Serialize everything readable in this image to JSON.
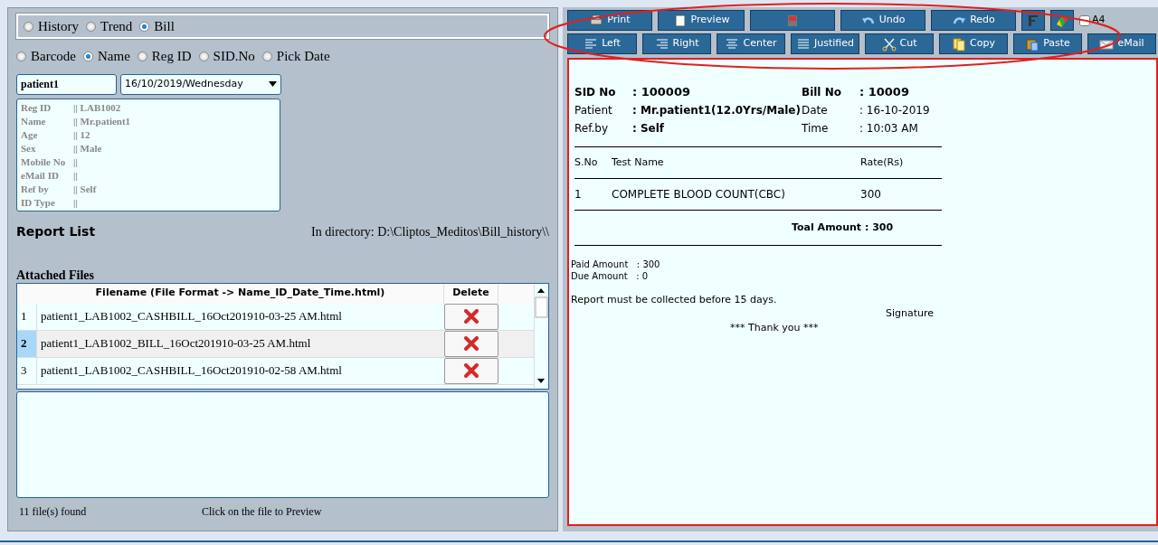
{
  "mode_options": [
    {
      "label": "History",
      "selected": false
    },
    {
      "label": "Trend",
      "selected": false
    },
    {
      "label": "Bill",
      "selected": true
    }
  ],
  "search_by": [
    {
      "label": "Barcode",
      "selected": false
    },
    {
      "label": "Name",
      "selected": true
    },
    {
      "label": "Reg ID",
      "selected": false
    },
    {
      "label": "SID.No",
      "selected": false
    },
    {
      "label": "Pick Date",
      "selected": false
    }
  ],
  "name_field": {
    "value": "patient1"
  },
  "date_dropdown": {
    "value": "16/10/2019/Wednesday"
  },
  "patient_info": [
    {
      "label": "Reg ID",
      "value": "|| LAB1002"
    },
    {
      "label": "Name",
      "value": "|| Mr.patient1"
    },
    {
      "label": "Age",
      "value": "|| 12"
    },
    {
      "label": "Sex",
      "value": "|| Male"
    },
    {
      "label": "Mobile No",
      "value": "||"
    },
    {
      "label": "eMail ID",
      "value": "||"
    },
    {
      "label": "Ref by",
      "value": "|| Self"
    },
    {
      "label": "ID Type",
      "value": "||"
    }
  ],
  "report_list": {
    "title": "Report List",
    "directory": "In directory:  D:\\Cliptos_Meditos\\Bill_history\\\\"
  },
  "attached_files": {
    "title": "Attached Files",
    "columns": [
      "Filename (File Format -> Name_ID_Date_Time.html)",
      "Delete"
    ],
    "rows": [
      {
        "index": "1",
        "filename": "patient1_LAB1002_CASHBILL_16Oct201910-03-25 AM.html",
        "selected": false
      },
      {
        "index": "2",
        "filename": "patient1_LAB1002_BILL_16Oct201910-03-25 AM.html",
        "selected": true
      },
      {
        "index": "3",
        "filename": "patient1_LAB1002_CASHBILL_16Oct201910-02-58 AM.html",
        "selected": false
      }
    ]
  },
  "status": {
    "count": "11 file(s) found",
    "hint": "Click on the file to Preview"
  },
  "toolbar_rows": [
    [
      {
        "kind": "print",
        "label": "Print"
      },
      {
        "kind": "preview",
        "label": "Preview"
      },
      {
        "kind": "pdf"
      },
      {
        "kind": "undo",
        "label": "Undo"
      },
      {
        "kind": "redo",
        "label": "Redo"
      },
      {
        "kind": "font"
      },
      {
        "kind": "color"
      },
      {
        "kind": "check",
        "label": "A4",
        "checked": false
      }
    ],
    [
      {
        "kind": "left",
        "label": "Left"
      },
      {
        "kind": "right",
        "label": "Right"
      },
      {
        "kind": "center",
        "label": "Center"
      },
      {
        "kind": "justified",
        "label": "Justified"
      },
      {
        "kind": "cut",
        "label": "Cut"
      },
      {
        "kind": "copy",
        "label": "Copy"
      },
      {
        "kind": "paste",
        "label": "Paste"
      },
      {
        "kind": "email",
        "label": "eMail"
      }
    ]
  ],
  "bill": {
    "left": [
      {
        "label": "SID No",
        "value": ": 100009"
      },
      {
        "label": "Patient",
        "value": ": Mr.patient1(12.0Yrs/Male)"
      },
      {
        "label": "Ref.by",
        "value": ": Self"
      }
    ],
    "right": [
      {
        "label": "Bill No",
        "value": ": 10009"
      },
      {
        "label": "Date",
        "value": ": 16-10-2019"
      },
      {
        "label": "Time",
        "value": ": 10:03 AM"
      }
    ],
    "columns": [
      "S.No",
      "Test Name",
      "Rate(Rs)"
    ],
    "items": [
      [
        "1",
        "COMPLETE BLOOD COUNT(CBC)",
        "300"
      ]
    ],
    "total": "Toal Amount : 300",
    "paid": "Paid Amount   : 300",
    "due": "Due Amount   : 0",
    "note": "Report must be collected before 15 days.",
    "signature": "Signature",
    "thanks": "*** Thank you ***"
  }
}
